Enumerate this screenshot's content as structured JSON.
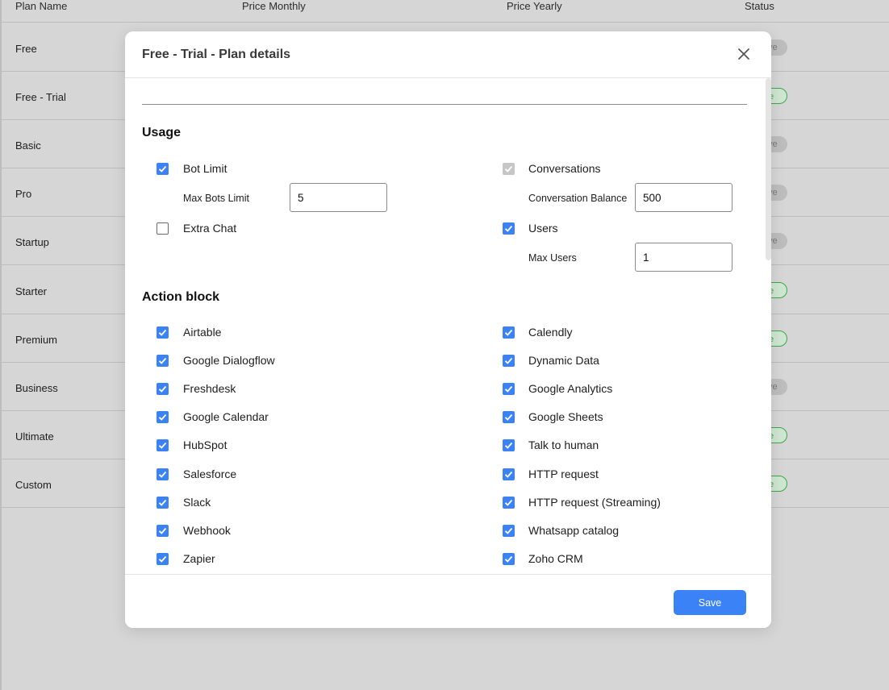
{
  "table": {
    "headers": [
      "Plan Name",
      "Price Monthly",
      "Price Yearly",
      "Status"
    ],
    "rows": [
      {
        "name": "Free",
        "status": "ve",
        "active": false
      },
      {
        "name": "Free - Trial",
        "status": "e",
        "active": true
      },
      {
        "name": "Basic",
        "status": "ve",
        "active": false
      },
      {
        "name": "Pro",
        "status": "ve",
        "active": false
      },
      {
        "name": "Startup",
        "status": "ve",
        "active": false
      },
      {
        "name": "Starter",
        "status": "e",
        "active": true
      },
      {
        "name": "Premium",
        "status": "e",
        "active": true
      },
      {
        "name": "Business",
        "status": "ve",
        "active": false
      },
      {
        "name": "Ultimate",
        "status": "e",
        "active": true
      },
      {
        "name": "Custom",
        "status": "e",
        "active": true
      }
    ]
  },
  "modal": {
    "title": "Free - Trial - Plan details",
    "usage_title": "Usage",
    "usage": {
      "bot_limit": {
        "label": "Bot Limit",
        "checked": true
      },
      "max_bots_label": "Max Bots Limit",
      "max_bots_value": "5",
      "extra_chat": {
        "label": "Extra Chat",
        "checked": false
      },
      "conversations": {
        "label": "Conversations",
        "checked": true,
        "disabled": true
      },
      "conversation_balance_label": "Conversation Balance",
      "conversation_balance_value": "500",
      "users": {
        "label": "Users",
        "checked": true
      },
      "max_users_label": "Max Users",
      "max_users_value": "1"
    },
    "action_block_title": "Action block",
    "actions_left": [
      {
        "label": "Airtable",
        "checked": true
      },
      {
        "label": "Google Dialogflow",
        "checked": true
      },
      {
        "label": "Freshdesk",
        "checked": true
      },
      {
        "label": "Google Calendar",
        "checked": true
      },
      {
        "label": "HubSpot",
        "checked": true
      },
      {
        "label": "Salesforce",
        "checked": true
      },
      {
        "label": "Slack",
        "checked": true
      },
      {
        "label": "Webhook",
        "checked": true
      },
      {
        "label": "Zapier",
        "checked": true
      }
    ],
    "actions_right": [
      {
        "label": "Calendly",
        "checked": true
      },
      {
        "label": "Dynamic Data",
        "checked": true
      },
      {
        "label": "Google Analytics",
        "checked": true
      },
      {
        "label": "Google Sheets",
        "checked": true
      },
      {
        "label": "Talk to human",
        "checked": true
      },
      {
        "label": "HTTP request",
        "checked": true
      },
      {
        "label": "HTTP request (Streaming)",
        "checked": true
      },
      {
        "label": "Whatsapp catalog",
        "checked": true
      },
      {
        "label": "Zoho CRM",
        "checked": true
      }
    ],
    "save_label": "Save"
  },
  "colors": {
    "accent": "#3b82f6",
    "active_status": "#3ca84b",
    "overlay": "#d6d6d6"
  }
}
